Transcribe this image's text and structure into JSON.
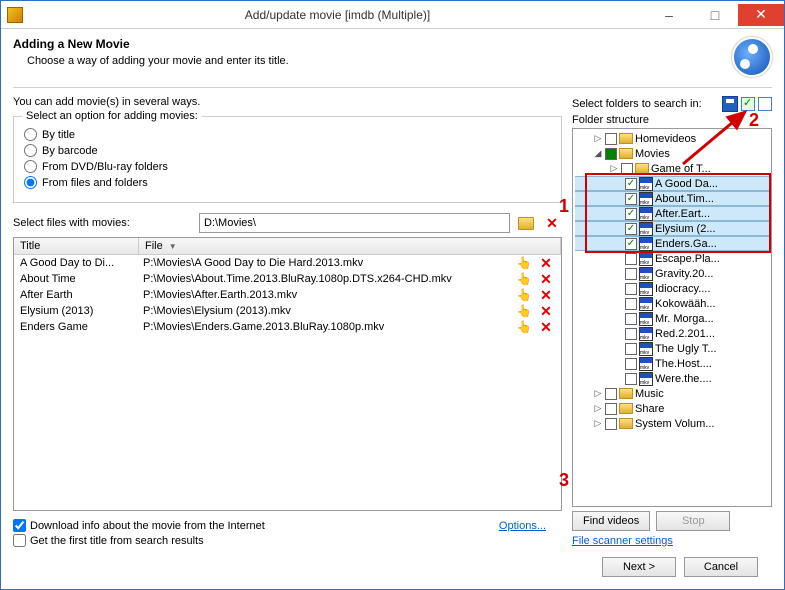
{
  "window": {
    "title": "Add/update movie [imdb (Multiple)]"
  },
  "header": {
    "title": "Adding a New Movie",
    "subtitle": "Choose a way of adding your movie and enter its title."
  },
  "ways_text": "You can add movie(s) in several ways.",
  "opt_group": {
    "title": "Select an option for adding movies:",
    "by_title": "By title",
    "by_barcode": "By barcode",
    "from_dvd": "From DVD/Blu-ray folders",
    "from_files": "From files and folders"
  },
  "files_label": "Select files with movies:",
  "path_value": "D:\\Movies\\",
  "table": {
    "col_title": "Title",
    "col_file": "File",
    "rows": [
      {
        "title": "A Good Day to Di...",
        "file": "P:\\Movies\\A Good Day to Die Hard.2013.mkv"
      },
      {
        "title": "About Time",
        "file": "P:\\Movies\\About.Time.2013.BluRay.1080p.DTS.x264-CHD.mkv"
      },
      {
        "title": "After Earth",
        "file": "P:\\Movies\\After.Earth.2013.mkv"
      },
      {
        "title": "Elysium (2013)",
        "file": "P:\\Movies\\Elysium (2013).mkv"
      },
      {
        "title": "Enders Game",
        "file": "P:\\Movies\\Enders.Game.2013.BluRay.1080p.mkv"
      }
    ]
  },
  "checks": {
    "download": "Download info about the movie from the Internet",
    "first_title": "Get the first title from search results",
    "options_link": "Options..."
  },
  "right": {
    "select_folders": "Select folders to search in:",
    "folder_structure": "Folder structure",
    "tree": {
      "homevideos": "Homevideos",
      "movies": "Movies",
      "game_of_t": "Game of T...",
      "a_good_da": "A Good Da...",
      "about_tim": "About.Tim...",
      "after_eart": "After.Eart...",
      "elysium_2": "Elysium (2...",
      "enders_ga": "Enders.Ga...",
      "escape_pla": "Escape.Pla...",
      "gravity_20": "Gravity.20...",
      "idiocracy": "Idiocracy....",
      "kokowaah": "Kokowääh...",
      "mr_morga": "Mr. Morga...",
      "red_2_201": "Red.2.201...",
      "the_ugly_t": "The Ugly T...",
      "the_host": "The.Host....",
      "were_the": "Were.the....",
      "music": "Music",
      "share": "Share",
      "system_vol": "System Volum..."
    },
    "find_videos": "Find videos",
    "stop": "Stop",
    "scanner_link": "File scanner settings"
  },
  "footer": {
    "next": "Next >",
    "cancel": "Cancel"
  },
  "annotations": {
    "n1": "1",
    "n2": "2",
    "n3": "3"
  }
}
